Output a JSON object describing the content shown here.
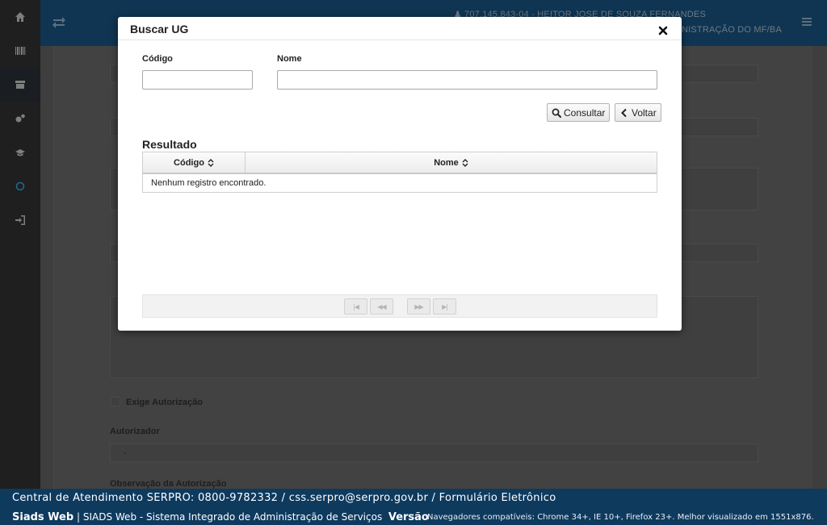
{
  "header": {
    "user": "707.145.843-04 - HEITOR JOSE DE SOUZA FERNANDES",
    "org": "ADMINISTRAÇÃO DO MF/BA"
  },
  "sidebar": {
    "icons": [
      "home-icon",
      "barcode-icon",
      "archive-icon",
      "gears-icon",
      "graduation-cap-icon",
      "circle-icon",
      "sign-in-icon"
    ]
  },
  "background_form": {
    "labels": [
      "Exige Autorização",
      "Autorizador",
      "Observação da Autorização"
    ],
    "autorizador_value": "-"
  },
  "modal": {
    "title": "Buscar UG",
    "codigo_label": "Código",
    "nome_label": "Nome",
    "codigo_value": "",
    "nome_value": "",
    "consultar_label": "Consultar",
    "voltar_label": "Voltar",
    "resultado_title": "Resultado",
    "columns": [
      "Código",
      "Nome"
    ],
    "empty_message": "Nenhum registro encontrado.",
    "pager": [
      "|◀",
      "◀◀",
      "▶▶",
      "▶|"
    ]
  },
  "footer": {
    "line1": "Central de Atendimento SERPRO: 0800-9782332 / css.serpro@serpro.gov.br / Formulário Eletrônico",
    "app_name": "Siads Web",
    "app_desc": "| SIADS Web - Sistema Integrado de Administração de Serviços",
    "version_label": "Versão",
    "compat": "Navegadores compatíveis: Chrome 34+, IE 10+, Firefox 23+. Melhor visualizado em 1551x876."
  },
  "colors": {
    "footer_bg": "#0e3a5e",
    "overlay": "#3d3d3d",
    "modal_bg": "#ffffff"
  }
}
